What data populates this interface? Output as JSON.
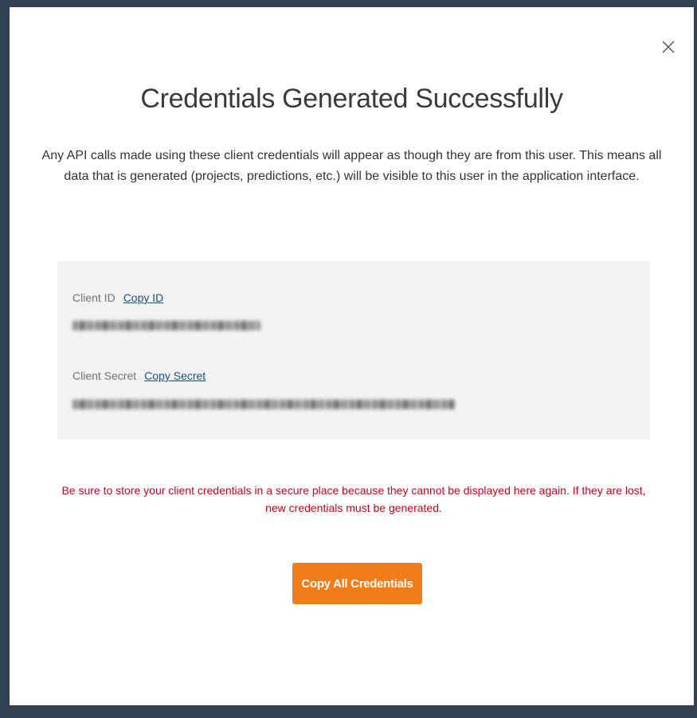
{
  "modal": {
    "title": "Credentials Generated Successfully",
    "description": "Any API calls made using these client credentials will appear as though they are from this user. This means all data that is generated (projects, predictions, etc.) will be visible to this user in the application interface.",
    "close_icon": "close-icon"
  },
  "credentials": {
    "client_id_label": "Client ID",
    "copy_id_label": "Copy ID",
    "client_secret_label": "Client Secret",
    "copy_secret_label": "Copy Secret"
  },
  "warning": "Be sure to store your client credentials in a secure place because they cannot be displayed here again. If they are lost, new credentials must be generated.",
  "actions": {
    "copy_all_label": "Copy All Credentials"
  },
  "colors": {
    "backdrop": "#2f4152",
    "accent_button": "#f07c1a",
    "warning_text": "#d0021b",
    "link": "#1f4f7a",
    "credential_panel": "#f3f3f3"
  }
}
